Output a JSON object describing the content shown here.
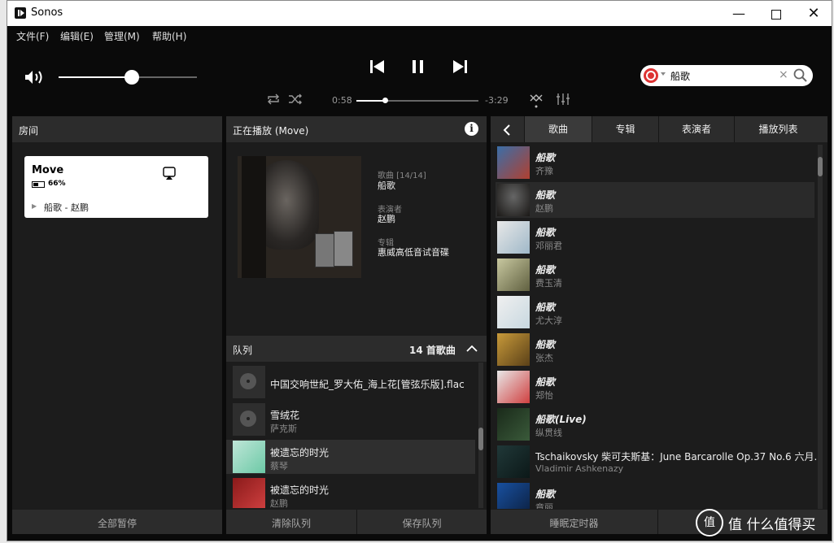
{
  "window": {
    "title": "Sonos"
  },
  "menu": [
    "文件(F)",
    "编辑(E)",
    "管理(M)",
    "帮助(H)"
  ],
  "player": {
    "elapsed": "0:58",
    "remaining": "-3:29",
    "progress": 0.23,
    "volume": 0.53
  },
  "search": {
    "value": "船歌"
  },
  "rooms": {
    "header": "房间",
    "room_name": "Move",
    "battery": "66%",
    "now_playing": "船歌 - 赵鹏",
    "footer": "全部暂停"
  },
  "nowplaying": {
    "header": "正在播放 (Move)",
    "song_label": "歌曲 [14/14]",
    "song": "船歌",
    "artist_label": "表演者",
    "artist": "赵鹏",
    "album_label": "专辑",
    "album": "惠威高低音试音碟"
  },
  "queue": {
    "header": "队列",
    "count": "14 首歌曲",
    "items": [
      {
        "title": "中国交响世紀_罗大佑_海上花[管弦乐版].flac",
        "artist": ""
      },
      {
        "title": "雪绒花",
        "artist": "萨克斯"
      },
      {
        "title": "被遗忘的时光",
        "artist": "蔡琴"
      },
      {
        "title": "被遗忘的时光",
        "artist": "赵鹏"
      }
    ],
    "clear": "清除队列",
    "save": "保存队列"
  },
  "library": {
    "tabs": [
      "歌曲",
      "专辑",
      "表演者",
      "播放列表"
    ],
    "items": [
      {
        "title": "船歌",
        "artist": "齐豫"
      },
      {
        "title": "船歌",
        "artist": "赵鹏"
      },
      {
        "title": "船歌",
        "artist": "邓丽君"
      },
      {
        "title": "船歌",
        "artist": "费玉清"
      },
      {
        "title": "船歌",
        "artist": "尤大淳"
      },
      {
        "title": "船歌",
        "artist": "张杰"
      },
      {
        "title": "船歌",
        "artist": "郑怡"
      },
      {
        "title": "船歌(Live)",
        "artist": "纵贯线"
      },
      {
        "title": "Tschaikovsky 柴可夫斯基：June Barcarolle Op.37 No.6 六月...",
        "artist": "Vladimir Ashkenazy"
      },
      {
        "title": "船歌",
        "artist": "章丽"
      }
    ],
    "sleep_timer": "睡眠定时器"
  },
  "watermark": "值 什么值得买",
  "colors": {
    "background": "#0a0a0a",
    "panel": "#1c1c1c",
    "panel_header": "#2c2c2c",
    "accent": "#ffffff"
  }
}
